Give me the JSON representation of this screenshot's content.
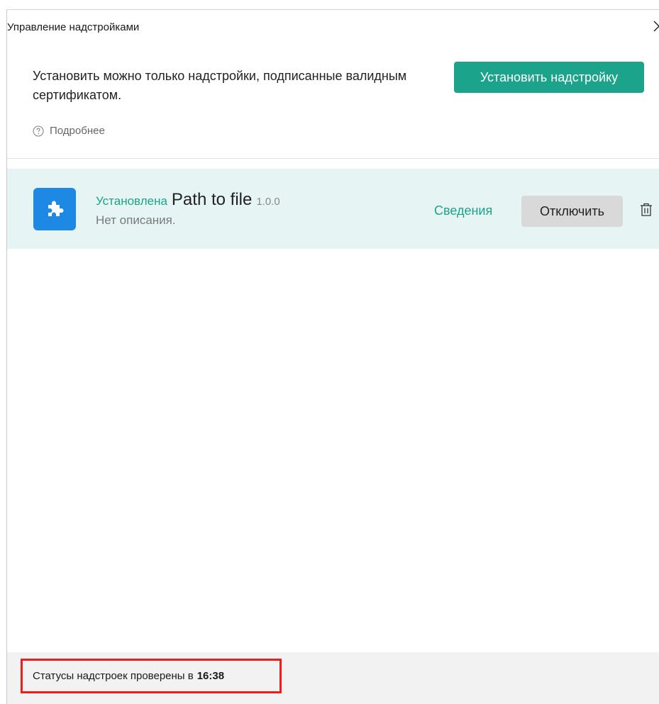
{
  "dialog": {
    "title": "Управление надстройками",
    "close_icon": "close-icon"
  },
  "header": {
    "info_text": "Установить можно только надстройки, подписанные валидным сертификатом.",
    "install_button_label": "Установить надстройку",
    "more_link_label": "Подробнее",
    "more_icon": "help-circle-icon"
  },
  "plugins": [
    {
      "status": "Установлена",
      "name": "Path to file",
      "version": "1.0.0",
      "description": "Нет описания.",
      "icon": "puzzle-piece-icon",
      "details_label": "Сведения",
      "disable_label": "Отключить",
      "delete_icon": "trash-icon"
    }
  ],
  "footer": {
    "status_text": "Статусы надстроек проверены в",
    "check_time": "16:38"
  },
  "colors": {
    "accent": "#1ba38c",
    "plugin_icon_bg": "#1e88e5",
    "row_highlight": "#e6f5f3",
    "annotation_border": "#ee1c1c"
  }
}
